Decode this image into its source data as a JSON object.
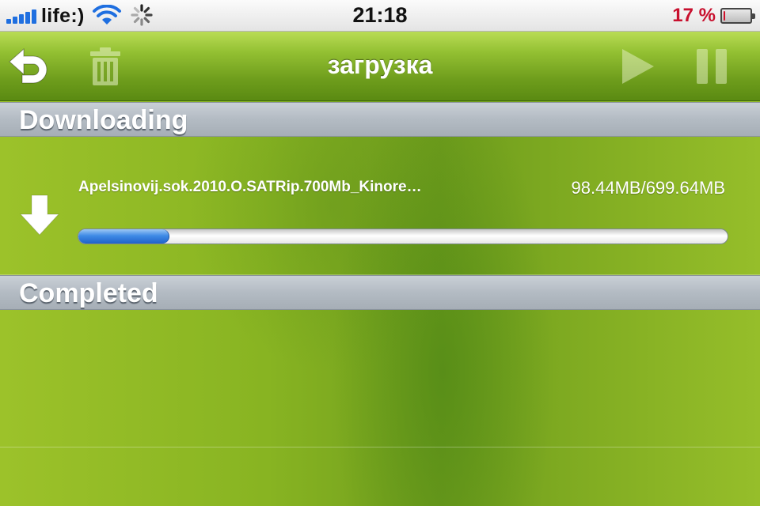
{
  "status_bar": {
    "carrier": "life:)",
    "time": "21:18",
    "battery_percent": "17 %",
    "battery_level": 0.17,
    "icons": [
      "signal-icon",
      "wifi-icon",
      "activity-spinner-icon",
      "battery-icon"
    ],
    "colors": {
      "signal": "#1f6fe0",
      "battery_low": "#c8102e"
    }
  },
  "nav": {
    "title": "загрузка",
    "buttons": [
      "back-arrow-icon",
      "trash-icon",
      "play-icon",
      "pause-icon"
    ]
  },
  "sections": {
    "downloading": "Downloading",
    "completed": "Completed"
  },
  "downloads": [
    {
      "name": "Apelsinovij.sok.2010.O.SATRip.700Mb_Kinore…",
      "size": "98.44MB/699.64MB",
      "progress": 0.1407,
      "icon": "download-arrow-icon"
    }
  ],
  "theme": {
    "background": "#86b122",
    "progress_fill": "#2f78dc",
    "section_header": "#b3bbc3"
  }
}
